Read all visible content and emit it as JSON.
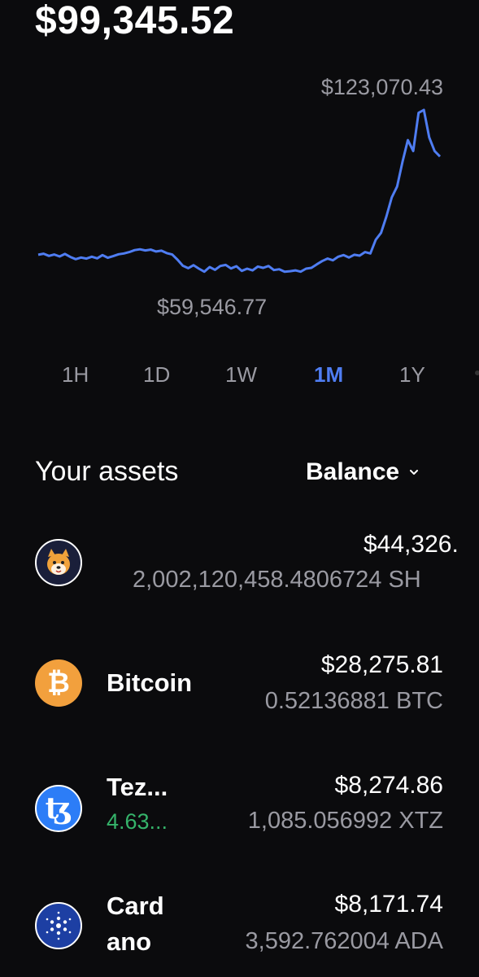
{
  "portfolio": {
    "total_balance": "$99,345.52",
    "chart_high": "$123,070.43",
    "chart_low": "$59,546.77"
  },
  "accent_color": "#4f7df2",
  "time_ranges": [
    {
      "label": "1H",
      "active": false
    },
    {
      "label": "1D",
      "active": false
    },
    {
      "label": "1W",
      "active": false
    },
    {
      "label": "1M",
      "active": true
    },
    {
      "label": "1Y",
      "active": false
    }
  ],
  "assets_section": {
    "title": "Your assets",
    "sort_label": "Balance"
  },
  "assets": [
    {
      "name": "",
      "change": "",
      "fiat": "$44,326.",
      "quantity": "2,002,120,458.4806724 SH",
      "icon": "shiba-inu-icon"
    },
    {
      "name": "Bitcoin",
      "change": "",
      "fiat": "$28,275.81",
      "quantity": "0.52136881 BTC",
      "icon": "bitcoin-icon"
    },
    {
      "name": "Tez...",
      "change": "4.63...",
      "fiat": "$8,274.86",
      "quantity": "1,085.056992 XTZ",
      "icon": "tezos-icon"
    },
    {
      "name_line1": "Card",
      "name_line2": "ano",
      "fiat": "$8,171.74",
      "quantity": "3,592.762004 ADA",
      "icon": "cardano-icon"
    }
  ],
  "chart_data": {
    "type": "line",
    "series": [
      {
        "values": [
          70000,
          70400,
          69600,
          70100,
          69400,
          70300,
          69200,
          68400,
          69000,
          68600,
          69300,
          68700,
          69900,
          68900,
          69500,
          70200,
          70500,
          71000,
          71700,
          72000,
          71600,
          71900,
          71200,
          71500,
          70600,
          70100,
          68200,
          66000,
          65100,
          66200,
          64900,
          63800,
          65500,
          64500,
          65900,
          66300,
          65000,
          65800,
          64100,
          64900,
          64300,
          65700,
          65200,
          65900,
          64400,
          64700,
          63800,
          64000,
          64300,
          63800,
          64900,
          65200,
          66500,
          67700,
          68600,
          68000,
          69300,
          69900,
          69000,
          70000,
          69700,
          71000,
          70500,
          75500,
          78000,
          84000,
          91000,
          95000,
          104000,
          112000,
          108000,
          122000,
          123070,
          113000,
          108000,
          106000
        ]
      }
    ],
    "annotations": [
      "$123,070.43",
      "$59,546.77"
    ]
  }
}
